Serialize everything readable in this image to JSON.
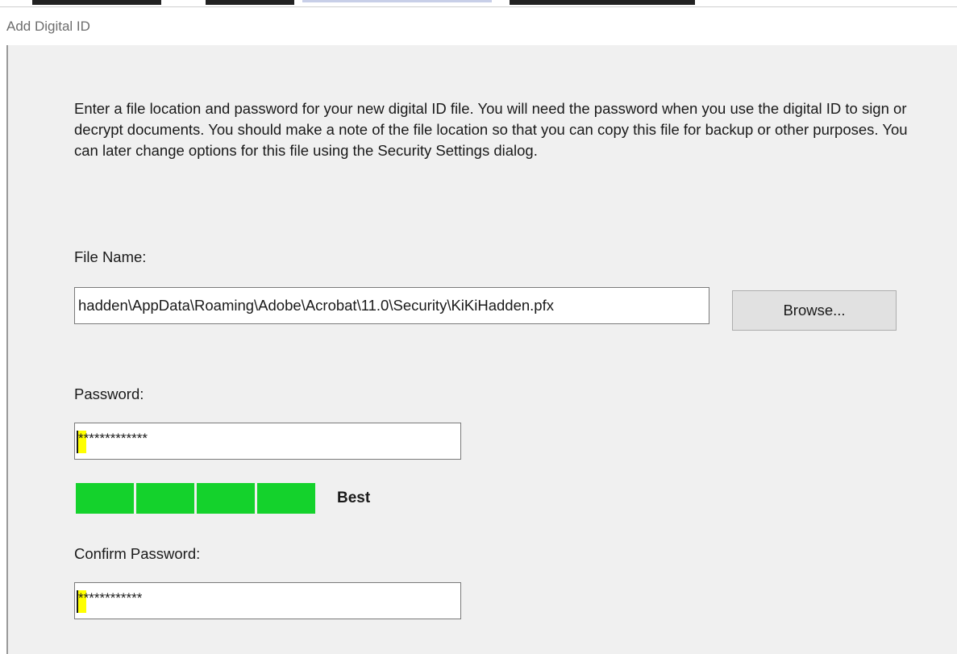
{
  "dialog": {
    "title": "Add Digital ID",
    "intro": "Enter a file location and password for your new digital ID file. You will need the password when you use the digital ID to sign or decrypt documents. You should make a note of the file location so that you can copy this file for backup or other purposes. You can later change options for this file using the Security Settings dialog."
  },
  "file": {
    "label": "File Name:",
    "value": "hadden\\AppData\\Roaming\\Adobe\\Acrobat\\11.0\\Security\\KiKiHadden.pfx",
    "browse_label": "Browse..."
  },
  "password": {
    "label": "Password:",
    "mask": "*************"
  },
  "strength": {
    "segments_filled": 4,
    "segments_total": 4,
    "label": "Best",
    "color": "#14d22c"
  },
  "confirm": {
    "label": "Confirm Password:",
    "mask": "************"
  },
  "colors": {
    "client_bg": "#f0f0f0",
    "caret_highlight": "#ffff00"
  }
}
